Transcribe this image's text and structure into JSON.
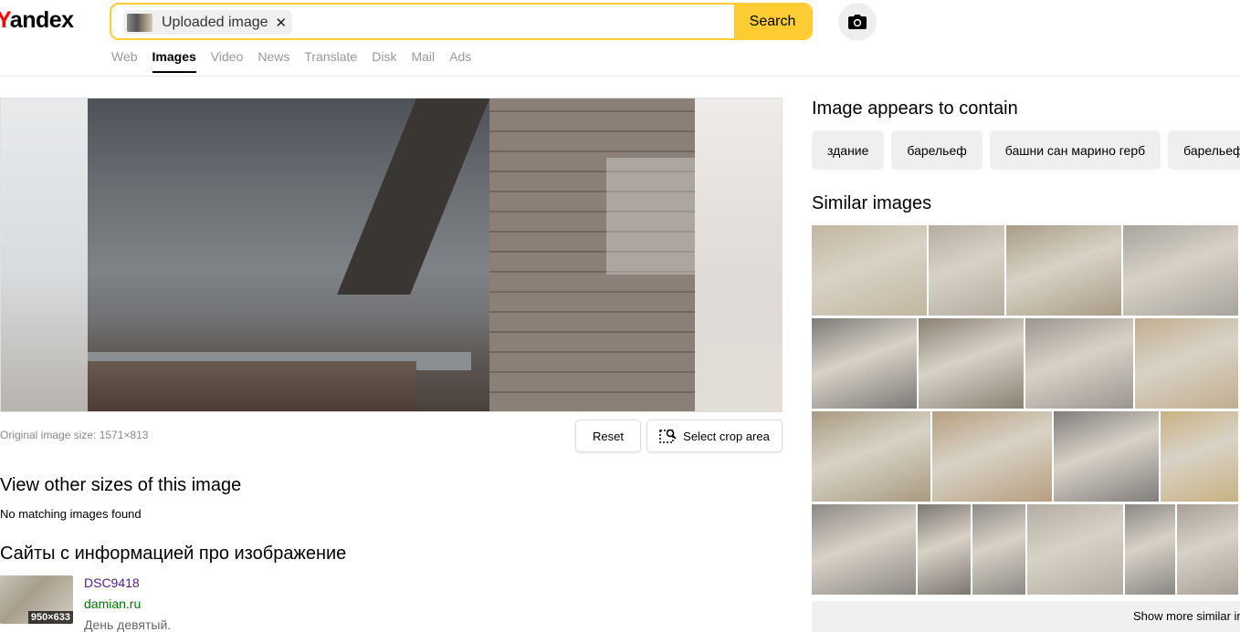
{
  "header": {
    "logo_first": "Y",
    "logo_rest": "andex",
    "search_chip_label": "Uploaded image",
    "search_button": "Search",
    "tabs": [
      {
        "label": "Web",
        "active": false
      },
      {
        "label": "Images",
        "active": true
      },
      {
        "label": "Video",
        "active": false
      },
      {
        "label": "News",
        "active": false
      },
      {
        "label": "Translate",
        "active": false
      },
      {
        "label": "Disk",
        "active": false
      },
      {
        "label": "Mail",
        "active": false
      },
      {
        "label": "Ads",
        "active": false
      }
    ]
  },
  "preview": {
    "original_size": "Original image size: 1571×813",
    "reset_label": "Reset",
    "crop_label": "Select crop area"
  },
  "other_sizes": {
    "title": "View other sizes of this image",
    "empty_text": "No matching images found"
  },
  "sites": {
    "title": "Сайты с информацией про изображение",
    "items": [
      {
        "thumb_size": "950×633",
        "link": "DSC9418",
        "domain": "damian.ru",
        "snippet": "День девятый."
      }
    ]
  },
  "contains": {
    "title": "Image appears to contain",
    "tags": [
      "здание",
      "барельеф",
      "башни сан марино герб",
      "барельеф"
    ]
  },
  "similar": {
    "title": "Similar images",
    "show_more": "Show more similar images",
    "colors": [
      "#c2b69f",
      "#b5aca0",
      "#a99c86",
      "#a7a49d",
      "#7c7a77",
      "#8a8074",
      "#9b9590",
      "#c2ae8f",
      "#a89a80",
      "#b79f80",
      "#7f7d7c",
      "#c9b283",
      "#8c8884",
      "#7b7670",
      "#8d8a86",
      "#b2aca3",
      "#8a8784",
      "#a79f95"
    ]
  },
  "colors": {
    "accent": "#ffcc33",
    "logo_red": "#ff0000",
    "visited_link": "#551a8b",
    "domain": "#007700"
  }
}
